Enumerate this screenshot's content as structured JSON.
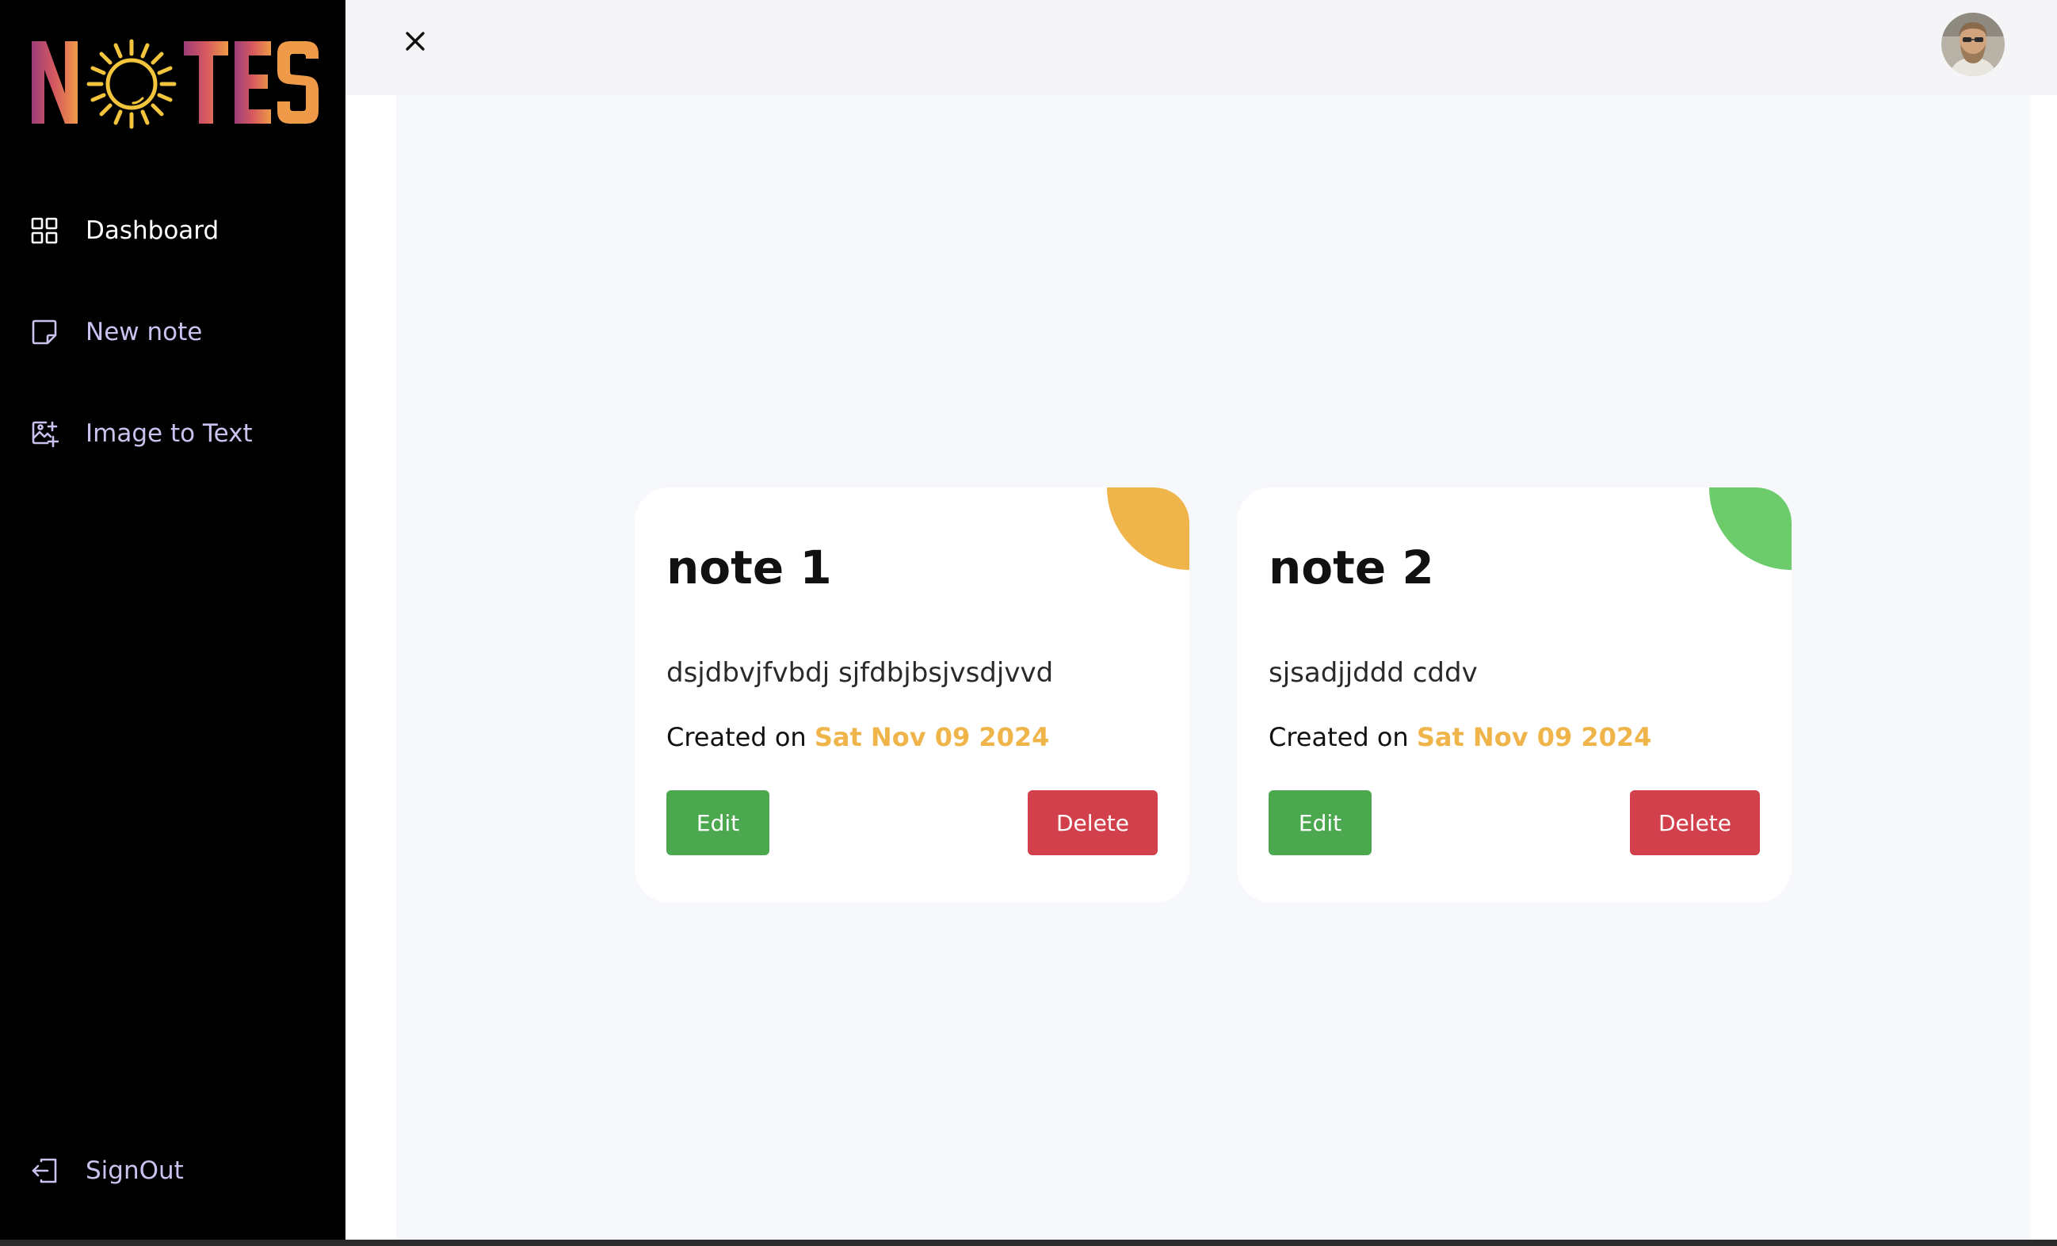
{
  "app": {
    "logo_text": "NOTES"
  },
  "sidebar": {
    "items": [
      {
        "label": "Dashboard",
        "icon": "grid-icon",
        "active": true
      },
      {
        "label": "New note",
        "icon": "note-icon",
        "active": false
      },
      {
        "label": "Image to Text",
        "icon": "image-add-icon",
        "active": false
      }
    ],
    "signout_label": "SignOut"
  },
  "topbar": {
    "close_icon": "close-icon",
    "avatar_icon": "user-avatar"
  },
  "notes": [
    {
      "title": "note 1",
      "body": "dsjdbvjfvbdj sjfdbjbsjvsdjvvd",
      "created_prefix": "Created on",
      "created_date": "Sat Nov 09 2024",
      "accent_color": "#efb54b",
      "edit_label": "Edit",
      "delete_label": "Delete"
    },
    {
      "title": "note 2",
      "body": "sjsadjjddd cddv",
      "created_prefix": "Created on",
      "created_date": "Sat Nov 09 2024",
      "accent_color": "#6ccb6a",
      "edit_label": "Edit",
      "delete_label": "Delete"
    }
  ],
  "colors": {
    "sidebar_bg": "#000000",
    "nav_text": "#c7c3ee",
    "date_text": "#efb54b",
    "edit_button": "#4ca84e",
    "delete_button": "#d2404c"
  }
}
